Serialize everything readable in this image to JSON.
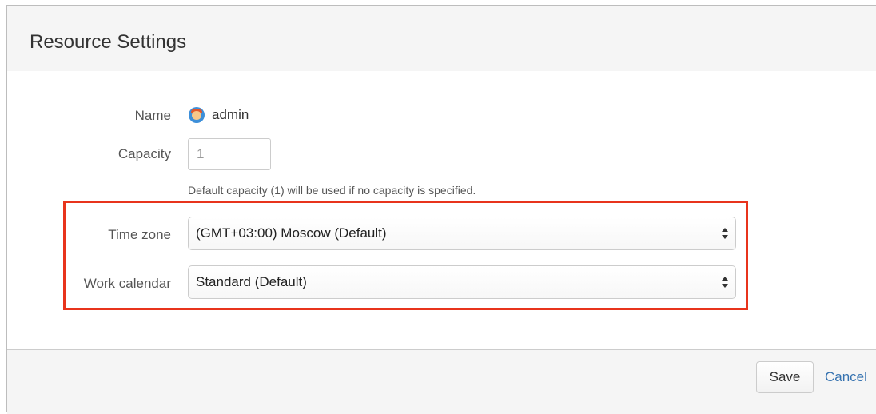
{
  "dialog": {
    "title": "Resource Settings"
  },
  "form": {
    "name": {
      "label": "Name",
      "value": "admin",
      "avatar_icon": "user-avatar-icon"
    },
    "capacity": {
      "label": "Capacity",
      "placeholder": "1",
      "help_text": "Default capacity (1) will be used if no capacity is specified."
    },
    "time_zone": {
      "label": "Time zone",
      "selected": "(GMT+03:00) Moscow (Default)"
    },
    "work_calendar": {
      "label": "Work calendar",
      "selected": "Standard (Default)"
    }
  },
  "footer": {
    "save_label": "Save",
    "cancel_label": "Cancel"
  },
  "colors": {
    "highlight_border": "#e8341c",
    "link": "#3572b0",
    "header_bg": "#f5f5f5"
  }
}
